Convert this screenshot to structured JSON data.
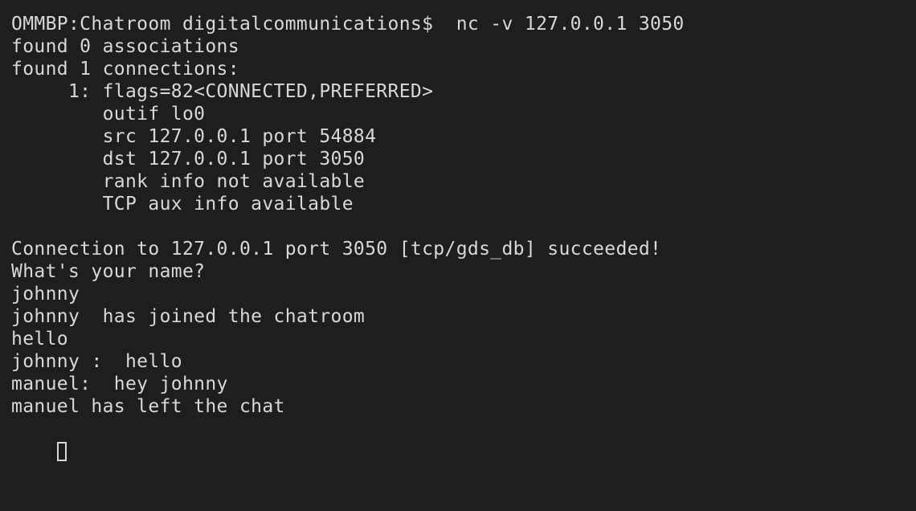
{
  "terminal": {
    "lines": [
      "OMMBP:Chatroom digitalcommunications$  nc -v 127.0.0.1 3050",
      "found 0 associations",
      "found 1 connections:",
      "     1: flags=82<CONNECTED,PREFERRED>",
      "        outif lo0",
      "        src 127.0.0.1 port 54884",
      "        dst 127.0.0.1 port 3050",
      "        rank info not available",
      "        TCP aux info available",
      "",
      "Connection to 127.0.0.1 port 3050 [tcp/gds_db] succeeded!",
      "What's your name?",
      "johnny",
      "johnny  has joined the chatroom",
      "hello",
      "johnny :  hello",
      "manuel:  hey johnny",
      "manuel has left the chat"
    ]
  }
}
